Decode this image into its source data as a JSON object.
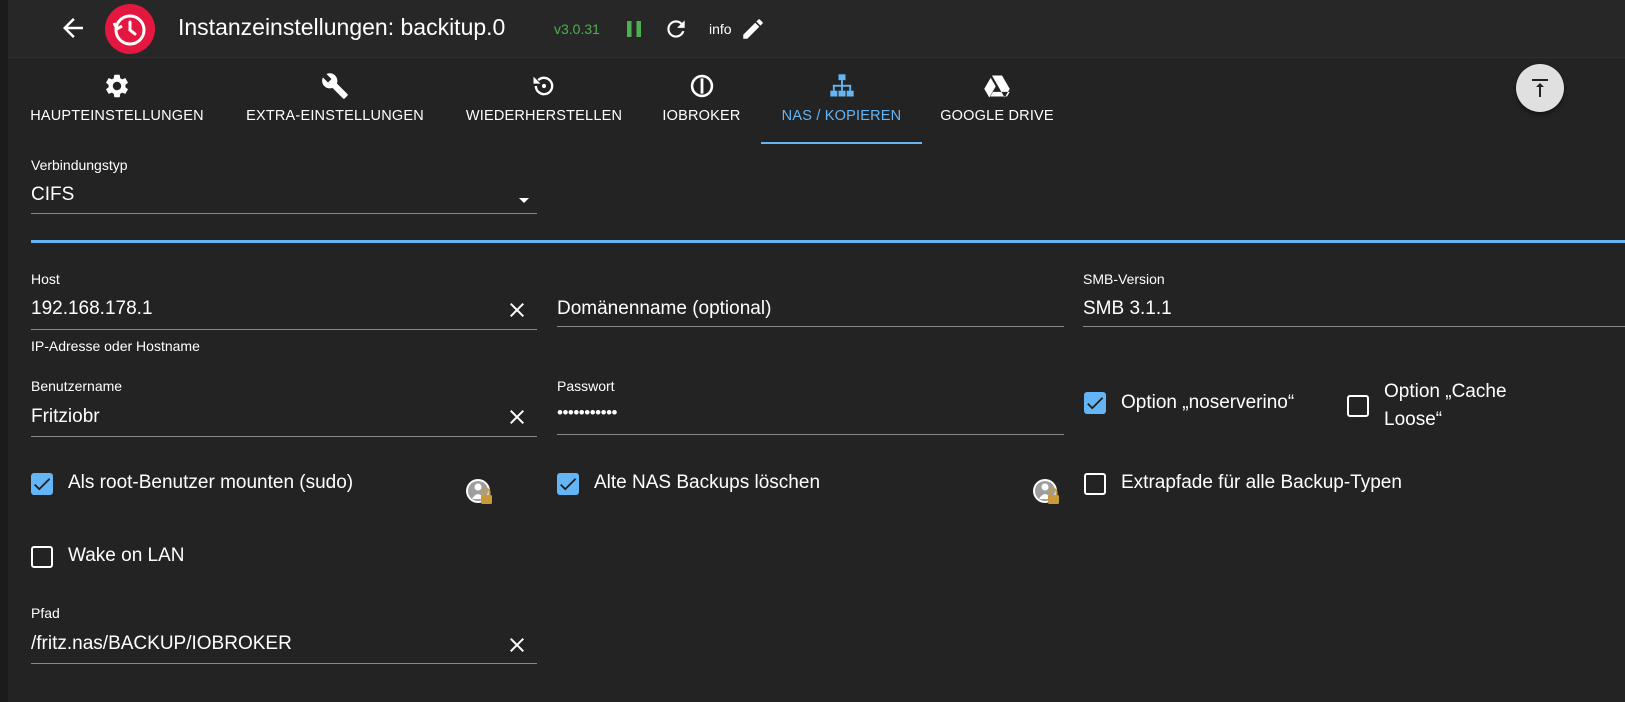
{
  "header": {
    "title": "Instanzeinstellungen: backitup.0",
    "version": "v3.0.31",
    "info": "info",
    "icons": [
      "back-arrow-icon",
      "backitup-logo",
      "pause-icon",
      "reload-icon",
      "edit-icon"
    ],
    "colors": {
      "version": "#4caf50",
      "logo": "#e3173f"
    }
  },
  "tabs": [
    {
      "label": "HAUPTEINSTELLUNGEN",
      "icon": "gear-icon"
    },
    {
      "label": "EXTRA-EINSTELLUNGEN",
      "icon": "wrench-icon"
    },
    {
      "label": "WIEDERHERSTELLEN",
      "icon": "restore-icon"
    },
    {
      "label": "IOBROKER",
      "icon": "iobroker-icon"
    },
    {
      "label": "NAS / KOPIEREN",
      "icon": "network-icon",
      "active": true
    },
    {
      "label": "GOOGLE DRIVE",
      "icon": "google-drive-icon"
    }
  ],
  "accent": "#64b5f6",
  "form": {
    "connection": {
      "label": "Verbindungstyp",
      "value": "CIFS"
    },
    "host": {
      "label": "Host",
      "value": "192.168.178.1",
      "helper": "IP-Adresse oder Hostname"
    },
    "domain": {
      "placeholder": "Domänenname (optional)"
    },
    "smb": {
      "label": "SMB-Version",
      "value": "SMB 3.1.1"
    },
    "user": {
      "label": "Benutzername",
      "value": "Fritziobr"
    },
    "password": {
      "label": "Passwort",
      "value": "•••••••••••"
    },
    "noserverino": {
      "label": "Option „noserverino“",
      "checked": true
    },
    "cacheloose": {
      "label": "Option „Cache Loose“",
      "checked": false
    },
    "sudo": {
      "label": "Als root-Benutzer mounten (sudo)",
      "checked": true
    },
    "deleteold": {
      "label": "Alte NAS Backups löschen",
      "checked": true
    },
    "extrapaths": {
      "label": "Extrapfade für alle Backup-Typen",
      "checked": false
    },
    "wol": {
      "label": "Wake on LAN",
      "checked": false
    },
    "path": {
      "label": "Pfad",
      "value": "/fritz.nas/BACKUP/IOBROKER"
    }
  }
}
